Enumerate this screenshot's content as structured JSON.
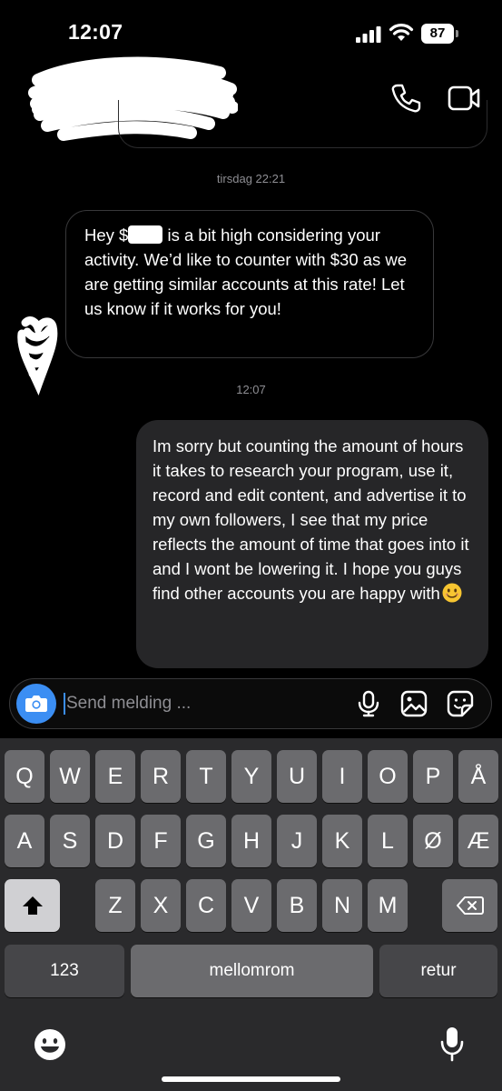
{
  "status_bar": {
    "time": "12:07",
    "battery": "87"
  },
  "header": {
    "name_redacted": true,
    "call_icon": "phone-icon",
    "video_icon": "video-camera-icon"
  },
  "thread": {
    "timestamp_1": "tirsdag 22:21",
    "incoming_message": {
      "prefix": "Hey $",
      "suffix": " is a bit high considering your activity. We’d like to counter with $30 as we are getting similar accounts at this rate! Let us know if it works for you!"
    },
    "timestamp_2": "12:07",
    "outgoing_message": {
      "text": "Im sorry but counting the amount of hours it takes to research your program, use it, record and edit content, and advertise it to my own followers, I see that my price reflects the amount of time that goes into it and I wont be lowering it. I hope you guys find other accounts you are happy with",
      "emoji": "smiling-face-emoji"
    }
  },
  "composer": {
    "placeholder": "Send melding ...",
    "accent_color": "#3b8ef3"
  },
  "keyboard": {
    "row1": [
      "Q",
      "W",
      "E",
      "R",
      "T",
      "Y",
      "U",
      "I",
      "O",
      "P",
      "Å"
    ],
    "row2": [
      "A",
      "S",
      "D",
      "F",
      "G",
      "H",
      "J",
      "K",
      "L",
      "Ø",
      "Æ"
    ],
    "row3": [
      "Z",
      "X",
      "C",
      "V",
      "B",
      "N",
      "M"
    ],
    "numbers_label": "123",
    "space_label": "mellomrom",
    "return_label": "retur"
  }
}
